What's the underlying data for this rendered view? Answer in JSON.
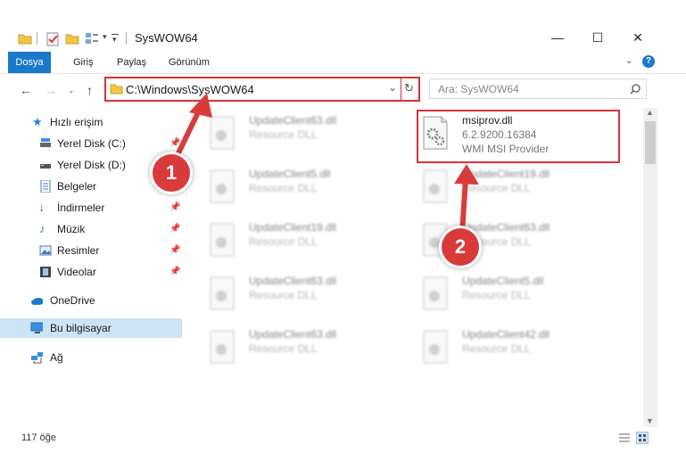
{
  "window": {
    "title": "SysWOW64",
    "minimize": "—",
    "maximize": "☐",
    "close": "✕"
  },
  "ribbon": {
    "tabs": [
      "Dosya",
      "Giriş",
      "Paylaş",
      "Görünüm"
    ]
  },
  "address": {
    "path": "C:\\Windows\\SysWOW64",
    "search_placeholder": "Ara: SysWOW64"
  },
  "sidebar": {
    "items": [
      {
        "label": "Hızlı erişim",
        "pinned": false
      },
      {
        "label": "Yerel Disk (C:)",
        "pinned": true
      },
      {
        "label": "Yerel Disk (D:)",
        "pinned": true
      },
      {
        "label": "Belgeler",
        "pinned": true
      },
      {
        "label": "İndirmeler",
        "pinned": true
      },
      {
        "label": "Müzik",
        "pinned": true
      },
      {
        "label": "Resimler",
        "pinned": true
      },
      {
        "label": "Videolar",
        "pinned": true
      },
      {
        "label": "OneDrive",
        "pinned": false
      },
      {
        "label": "Bu bilgisayar",
        "pinned": false
      },
      {
        "label": "Ağ",
        "pinned": false
      }
    ]
  },
  "files": {
    "highlighted": {
      "name": "msiprov.dll",
      "version": "6.2.9200.16384",
      "description": "WMI MSI Provider"
    },
    "left_column": [
      {
        "name": "UpdateClient63.dll",
        "type": "Resource DLL"
      },
      {
        "name": "UpdateClient5.dll",
        "type": "Resource DLL"
      },
      {
        "name": "UpdateClient19.dll",
        "type": "Resource DLL"
      },
      {
        "name": "UpdateClient63.dll",
        "type": "Resource DLL"
      },
      {
        "name": "UpdateClient63.dll",
        "type": "Resource DLL"
      }
    ],
    "right_column": [
      {
        "name": "UpdateClient19.dll",
        "type": "Resource DLL"
      },
      {
        "name": "UpdateClient63.dll",
        "type": "Resource DLL"
      },
      {
        "name": "UpdateClient5.dll",
        "type": "Resource DLL"
      },
      {
        "name": "UpdateClient42.dll",
        "type": "Resource DLL"
      }
    ]
  },
  "status": {
    "item_count": "117 öğe"
  },
  "annotations": {
    "badge1": "1",
    "badge2": "2",
    "color": "#d9303a"
  }
}
